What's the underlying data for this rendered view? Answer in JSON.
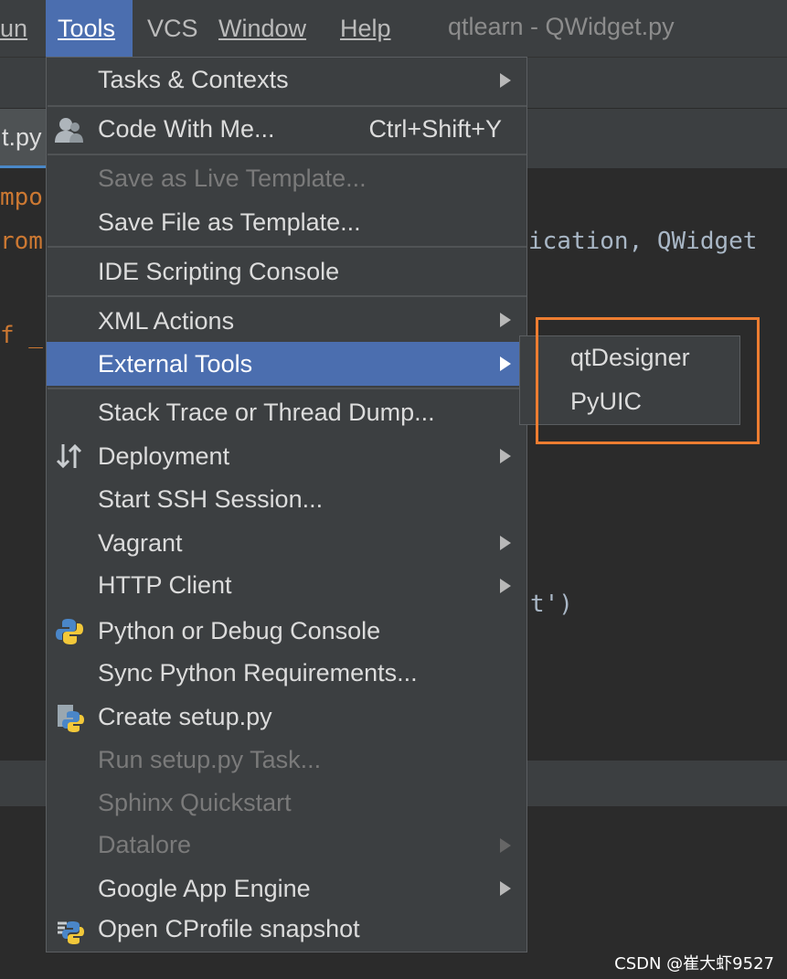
{
  "menubar": {
    "items": [
      {
        "label": "Run",
        "partial": "un"
      },
      {
        "label": "Tools"
      },
      {
        "label": "VCS"
      },
      {
        "label": "Window"
      },
      {
        "label": "Help"
      }
    ],
    "window_title": "qtlearn - QWidget.py"
  },
  "editor": {
    "tab_label": "t.py",
    "line1_fragment": "mpor",
    "line2_fragment": "rom",
    "line2_tail": "ication, QWidget",
    "line3_fragment": "f _",
    "line4_fragment": "t')"
  },
  "tools_menu": {
    "items": [
      {
        "label": "Tasks & Contexts",
        "submenu": true
      },
      {
        "label": "Code With Me...",
        "shortcut": "Ctrl+Shift+Y",
        "icon": "user-icon"
      },
      {
        "label": "Save as Live Template...",
        "disabled": true
      },
      {
        "label": "Save File as Template..."
      },
      {
        "label": "IDE Scripting Console"
      },
      {
        "label": "XML Actions",
        "submenu": true
      },
      {
        "label": "External Tools",
        "submenu": true,
        "active": true
      },
      {
        "label": "Stack Trace or Thread Dump..."
      },
      {
        "label": "Deployment",
        "submenu": true,
        "icon": "deployment-arrows-icon"
      },
      {
        "label": "Start SSH Session..."
      },
      {
        "label": "Vagrant",
        "submenu": true
      },
      {
        "label": "HTTP Client",
        "submenu": true
      },
      {
        "label": "Python or Debug Console",
        "icon": "python-console-icon"
      },
      {
        "label": "Sync Python Requirements..."
      },
      {
        "label": "Create setup.py",
        "icon": "python-setup-icon"
      },
      {
        "label": "Run setup.py Task...",
        "disabled": true
      },
      {
        "label": "Sphinx Quickstart",
        "disabled": true
      },
      {
        "label": "Datalore",
        "submenu": true,
        "disabled": true
      },
      {
        "label": "Google App Engine",
        "submenu": true
      },
      {
        "label": "Open CProfile snapshot",
        "icon": "python-profile-icon"
      }
    ]
  },
  "external_tools_submenu": {
    "items": [
      {
        "label": "qtDesigner"
      },
      {
        "label": "PyUIC"
      }
    ]
  },
  "watermark": "CSDN @崔大虾9527",
  "colors": {
    "menu_bg": "#3c3f41",
    "selection": "#4b6eaf",
    "editor_bg": "#2b2b2b",
    "highlight_box": "#ed7d31",
    "keyword": "#cc7832",
    "disabled_text": "#7a7a7a"
  }
}
